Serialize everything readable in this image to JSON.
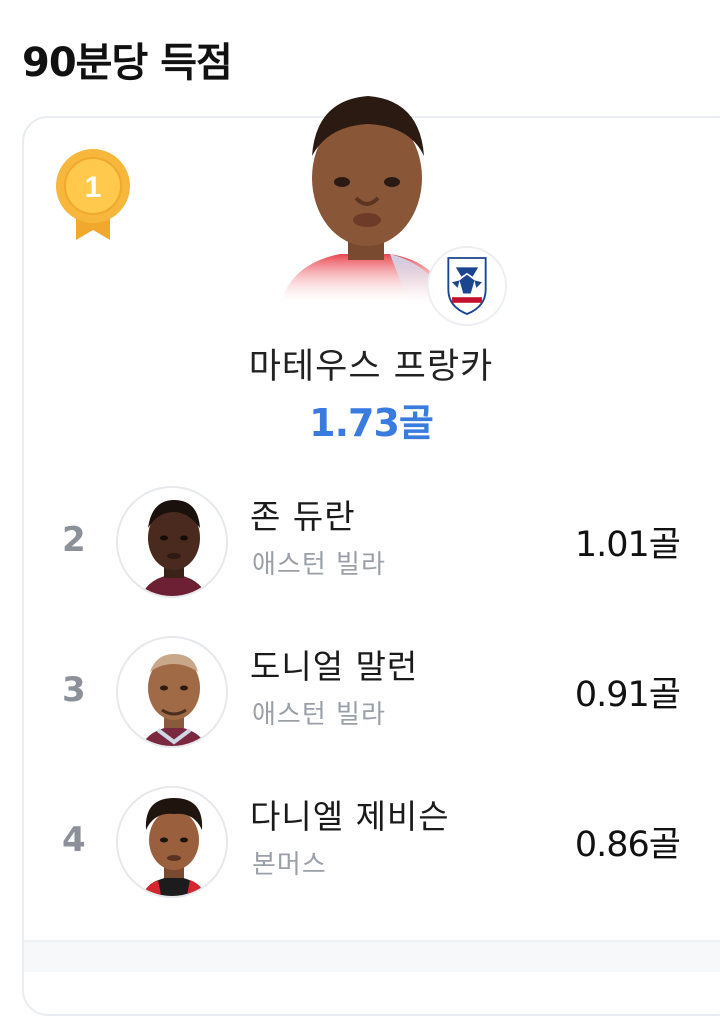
{
  "page": {
    "title": "90분당 득점"
  },
  "leader": {
    "rank": "1",
    "name": "마테우스 프랑카",
    "value": "1.73골",
    "club_badge": "crystal-palace-badge-icon"
  },
  "ranking": [
    {
      "rank": "2",
      "name": "존 듀란",
      "team": "애스턴 빌라",
      "value": "1.01골"
    },
    {
      "rank": "3",
      "name": "도니얼 말런",
      "team": "애스턴 빌라",
      "value": "0.91골"
    },
    {
      "rank": "4",
      "name": "다니엘 제비슨",
      "team": "본머스",
      "value": "0.86골"
    }
  ],
  "colors": {
    "accent": "#3a7be0",
    "medal_gold": "#f6b73c",
    "rank_gray": "#8c9099",
    "team_gray": "#9aa0a8"
  }
}
